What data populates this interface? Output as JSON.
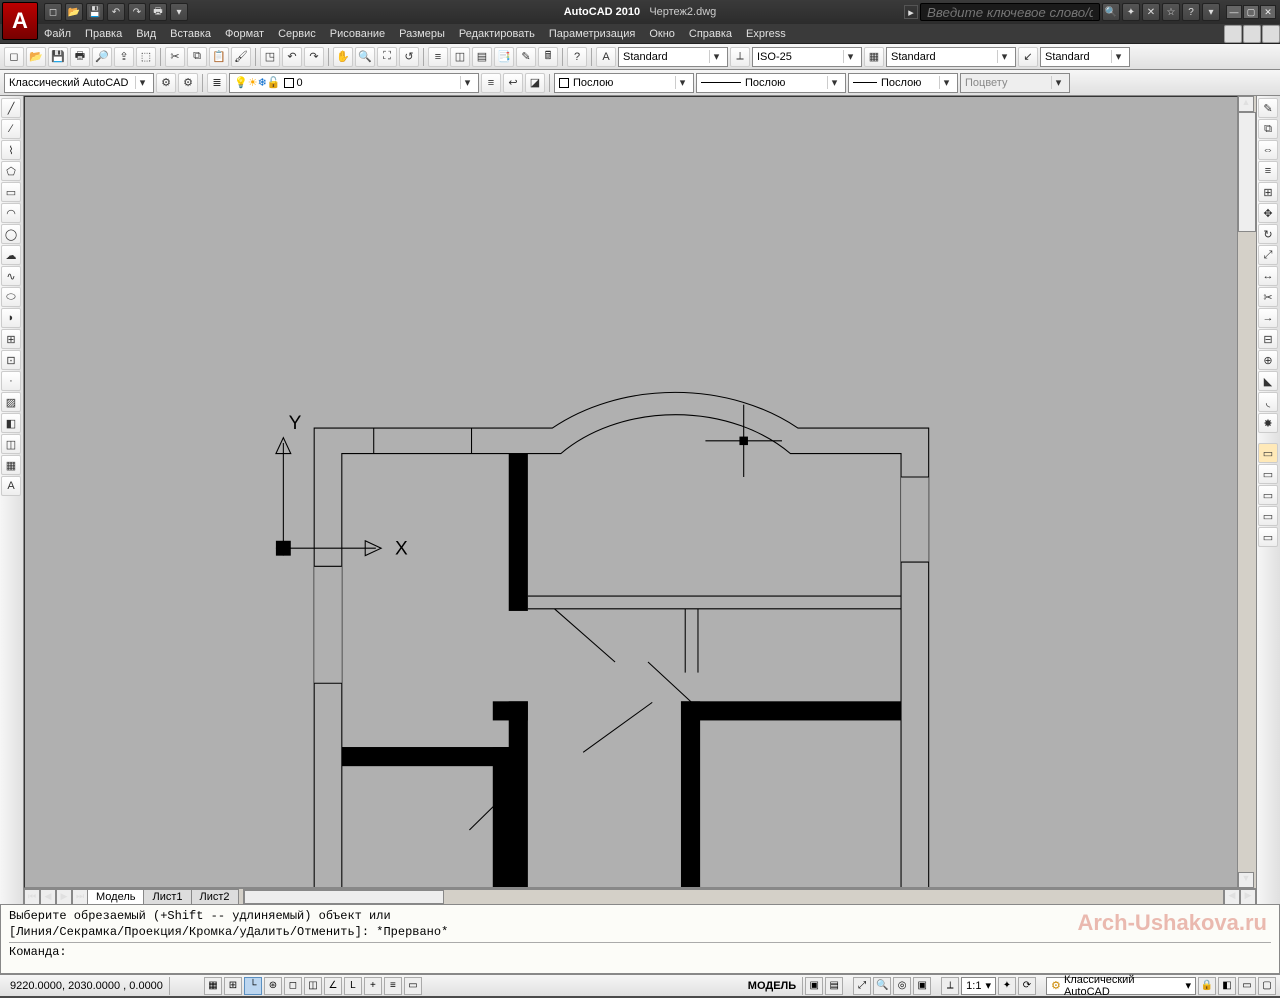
{
  "title": {
    "app": "AutoCAD 2010",
    "doc": "Чертеж2.dwg"
  },
  "search_placeholder": "Введите ключевое слово/фразу",
  "menus": [
    "Файл",
    "Правка",
    "Вид",
    "Вставка",
    "Формат",
    "Сервис",
    "Рисование",
    "Размеры",
    "Редактировать",
    "Параметризация",
    "Окно",
    "Справка",
    "Express"
  ],
  "tb1": {
    "textstyle": "Standard",
    "dimstyle": "ISO-25",
    "tablestyle": "Standard",
    "mleaderstyle": "Standard"
  },
  "tb2": {
    "workspace": "Классический AutoCAD",
    "layer": "0",
    "color": "Послою",
    "linetype": "Послою",
    "lineweight": "Послою",
    "plotstyle": "Поцвету"
  },
  "canvas": {
    "x_label": "X",
    "y_label": "Y"
  },
  "tabs": {
    "model": "Модель",
    "layouts": [
      "Лист1",
      "Лист2"
    ]
  },
  "cmd": {
    "line1": "Выберите обрезаемый (+Shift -- удлиняемый) объект или",
    "line2": "[Линия/Секрамка/Проекция/Кромка/уДалить/Отменить]: *Прервано*",
    "prompt_label": "Команда:",
    "prompt_value": ""
  },
  "watermark": "Arch-Ushakova.ru",
  "status": {
    "coords": "9220.0000, 2030.0000 , 0.0000",
    "space": "МОДЕЛЬ",
    "scale": "1:1",
    "workspace": "Классический AutoCAD"
  }
}
